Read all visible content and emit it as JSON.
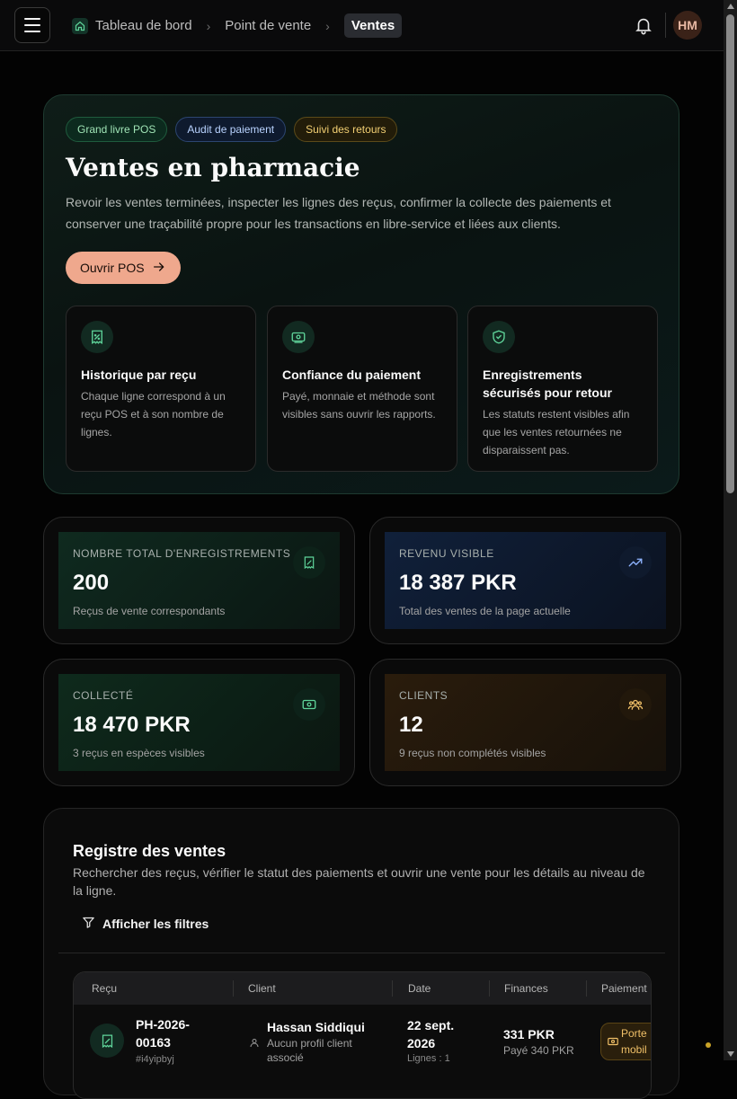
{
  "topbar": {
    "breadcrumbs": [
      "Tableau de bord",
      "Point de vente",
      "Ventes"
    ],
    "avatar_initials": "HM"
  },
  "hero": {
    "pills": [
      "Grand livre POS",
      "Audit de paiement",
      "Suivi des retours"
    ],
    "title": "Ventes en pharmacie",
    "description": "Revoir les ventes terminées, inspecter les lignes des reçus, confirmer la collecte des paiements et conserver une traçabilité propre pour les transactions en libre-service et liées aux clients.",
    "cta_label": "Ouvrir POS",
    "features": [
      {
        "icon": "receipt-icon",
        "title": "Historique par reçu",
        "description": "Chaque ligne correspond à un reçu POS et à son nombre de lignes."
      },
      {
        "icon": "banknote-icon",
        "title": "Confiance du paiement",
        "description": "Payé, monnaie et méthode sont visibles sans ouvrir les rapports."
      },
      {
        "icon": "shield-check-icon",
        "title": "Enregistrements sécurisés pour retour",
        "description": "Les statuts restent visibles afin que les ventes retournées ne disparaissent pas."
      }
    ]
  },
  "stats": [
    {
      "label": "NOMBRE TOTAL D'ENREGISTREMENTS",
      "value": "200",
      "sub": "Reçus de vente correspondants",
      "icon": "receipt-icon"
    },
    {
      "label": "REVENU VISIBLE",
      "value": "18 387 PKR",
      "sub": "Total des ventes de la page actuelle",
      "icon": "trending-up-icon"
    },
    {
      "label": "COLLECTÉ",
      "value": "18 470 PKR",
      "sub": "3 reçus en espèces visibles",
      "icon": "banknote-icon"
    },
    {
      "label": "CLIENTS",
      "value": "12",
      "sub": "9 reçus non complétés visibles",
      "icon": "users-icon"
    }
  ],
  "registry": {
    "title": "Registre des ventes",
    "description": "Rechercher des reçus, vérifier le statut des paiements et ouvrir une vente pour les détails au niveau de la ligne.",
    "filters_label": "Afficher les filtres",
    "columns": [
      "Reçu",
      "Client",
      "Date",
      "Finances",
      "Paiement"
    ],
    "rows": [
      {
        "receipt_line1": "PH-2026-",
        "receipt_line2": "00163",
        "receipt_hash": "#i4yipbyj",
        "client_name": "Hassan Siddiqui",
        "client_note_line1": "Aucun profil client",
        "client_note_line2": "associé",
        "date_line1": "22 sept.",
        "date_line2": "2026",
        "date_sub": "Lignes : 1",
        "amount": "331 PKR",
        "paid": "Payé 340 PKR",
        "payment_line1": "Porte",
        "payment_line2": "mobil"
      }
    ]
  },
  "colors": {
    "accent_salmon": "#efa88d",
    "green": "#5fd49a",
    "blue": "#8fb4ff",
    "amber": "#f0c068"
  }
}
